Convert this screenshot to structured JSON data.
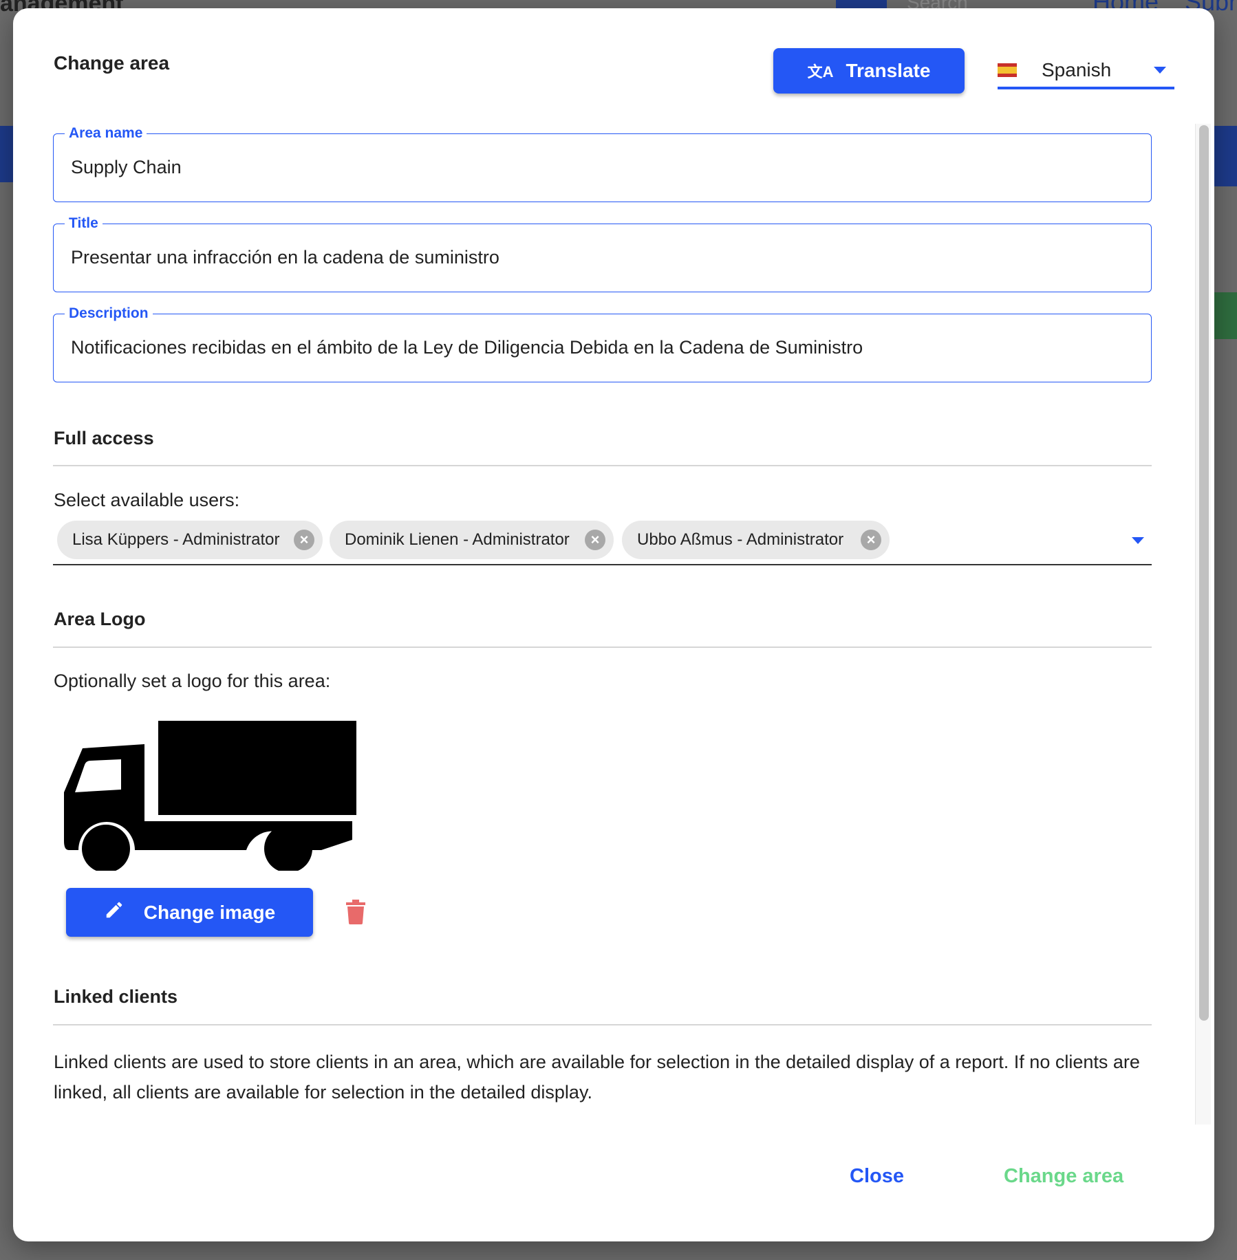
{
  "background": {
    "header_fragment": "anagement",
    "search_placeholder": "Search",
    "nav_home": "Home",
    "nav_submit": "Subr"
  },
  "modal": {
    "title": "Change area",
    "translate_label": "Translate",
    "language": {
      "flag": "spain-flag-icon",
      "selected": "Spanish"
    },
    "fields": {
      "area_name": {
        "label": "Area name",
        "value": "Supply Chain"
      },
      "title": {
        "label": "Title",
        "value": "Presentar una infracción en la cadena de suministro"
      },
      "description": {
        "label": "Description",
        "value": "Notificaciones recibidas en el ámbito de la Ley de Diligencia Debida en la Cadena de Suministro"
      }
    },
    "full_access": {
      "heading": "Full access",
      "select_label": "Select available users:",
      "users": [
        "Lisa Küppers - Administrator",
        "Dominik Lienen - Administrator",
        "Ubbo Aßmus - Administrator"
      ]
    },
    "logo": {
      "heading": "Area Logo",
      "hint": "Optionally set a logo for this area:",
      "image": "truck-icon",
      "change_label": "Change image"
    },
    "linked_clients": {
      "heading": "Linked clients",
      "text": "Linked clients are used to store clients in an area, which are available for selection in the detailed display of a report. If no clients are linked, all clients are available for selection in the detailed display."
    },
    "footer": {
      "close_label": "Close",
      "submit_label": "Change area"
    },
    "colors": {
      "primary": "#2457f5",
      "success": "#6ad88a",
      "danger": "#e86a6a"
    }
  }
}
